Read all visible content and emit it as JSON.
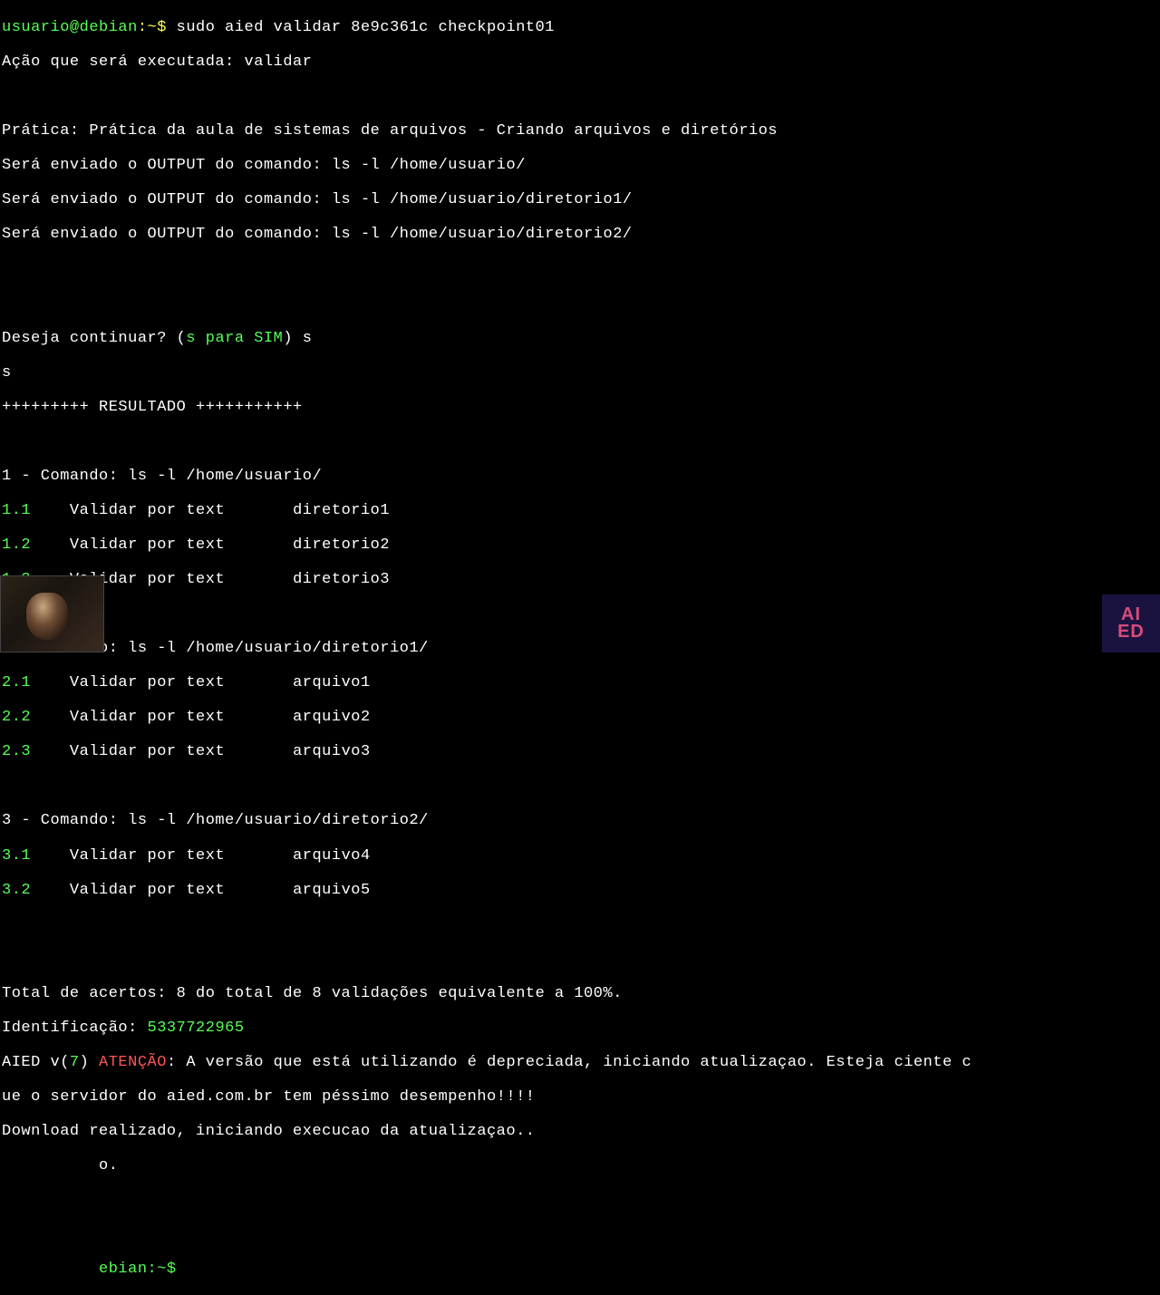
{
  "prompt1": {
    "user_host": "usuario@debian",
    "cwd": ":~$",
    "cmd": " sudo aied validar 8e9c361c checkpoint01"
  },
  "action_line": "Ação que será executada: validar",
  "pratica": "Prática: Prática da aula de sistemas de arquivos - Criando arquivos e diretórios",
  "output_lines": [
    "Será enviado o OUTPUT do comando: ls -l /home/usuario/",
    "Será enviado o OUTPUT do comando: ls -l /home/usuario/diretorio1/",
    "Será enviado o OUTPUT do comando: ls -l /home/usuario/diretorio2/"
  ],
  "continue_q": "Deseja continuar? (",
  "continue_hint": "s para SIM",
  "continue_end": ") s",
  "input_s": "s",
  "result_header": "+++++++++ RESULTADO +++++++++++",
  "sections": [
    {
      "header": "1 - Comando: ls -l /home/usuario/",
      "items": [
        {
          "num": "1.1",
          "mid": "    Validar por text       ",
          "val": "diretorio1"
        },
        {
          "num": "1.2",
          "mid": "    Validar por text       ",
          "val": "diretorio2"
        },
        {
          "num": "1.3",
          "mid": "    Validar por text       ",
          "val": "diretorio3"
        }
      ]
    },
    {
      "header": "2 - Comando: ls -l /home/usuario/diretorio1/",
      "items": [
        {
          "num": "2.1",
          "mid": "    Validar por text       ",
          "val": "arquivo1"
        },
        {
          "num": "2.2",
          "mid": "    Validar por text       ",
          "val": "arquivo2"
        },
        {
          "num": "2.3",
          "mid": "    Validar por text       ",
          "val": "arquivo3"
        }
      ]
    },
    {
      "header": "3 - Comando: ls -l /home/usuario/diretorio2/",
      "items": [
        {
          "num": "3.1",
          "mid": "    Validar por text       ",
          "val": "arquivo4"
        },
        {
          "num": "3.2",
          "mid": "    Validar por text       ",
          "val": "arquivo5"
        }
      ]
    }
  ],
  "total": "Total de acertos: 8 do total de 8 validações equivalente a 100%.",
  "ident_label": "Identificação: ",
  "ident_value": "5337722965",
  "aied_prefix": "AIED v(",
  "aied_ver": "7",
  "aied_paren": ") ",
  "aied_warn": "ATENÇÃO",
  "aied_msg1": ": A versão que está utilizando é depreciada, iniciando atualizaçao. Esteja ciente c",
  "aied_msg2": "ue o servidor do aied.com.br tem péssimo desempenho!!!!",
  "download": "Download realizado, iniciando execucao da atualizaçao..",
  "dot_line": "          o.",
  "prompt2_prefix": "          ebian:~$",
  "logo": {
    "line1": "AI",
    "line2": "ED"
  }
}
